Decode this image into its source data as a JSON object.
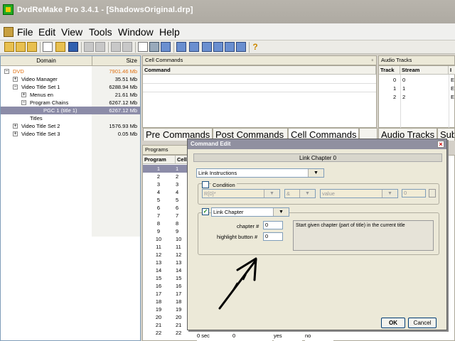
{
  "window": {
    "title": "DvdReMake Pro 3.4.1 - [ShadowsOriginal.drp]"
  },
  "menu": {
    "items": [
      "File",
      "Edit",
      "View",
      "Tools",
      "Window",
      "Help"
    ]
  },
  "tree": {
    "headers": {
      "domain": "Domain",
      "size": "Size"
    },
    "rows": [
      {
        "name": "DVD",
        "size": "7901.46 Mb",
        "orange": true
      },
      {
        "name": "Video Manager",
        "size": "35.51 Mb"
      },
      {
        "name": "Video Title Set 1",
        "size": "6288.94 Mb"
      },
      {
        "name": "Menus en",
        "size": "21.61 Mb"
      },
      {
        "name": "Program Chains",
        "size": "6267.12 Mb"
      },
      {
        "name": "PGC 1 (title 1)",
        "size": "6267.12 Mb",
        "selected": true
      },
      {
        "name": "Titles",
        "size": ""
      },
      {
        "name": "Video Title Set 2",
        "size": "1576.93 Mb"
      },
      {
        "name": "Video Title Set 3",
        "size": "0.05 Mb"
      }
    ]
  },
  "cell_commands": {
    "title": "Cell Commands",
    "column": "Command"
  },
  "audio_tracks": {
    "title": "Audio Tracks",
    "columns": [
      "Track",
      "Stream",
      "I"
    ],
    "rows": [
      [
        "0",
        "0",
        "E"
      ],
      [
        "1",
        "1",
        "E"
      ],
      [
        "2",
        "2",
        "E"
      ]
    ]
  },
  "tabs": [
    "Pre Commands",
    "Post Commands",
    "Cell Commands",
    "",
    "Audio Tracks",
    "Sub"
  ],
  "programs": {
    "title": "Programs",
    "columns": [
      "Program",
      "Cells"
    ],
    "rows": [
      [
        "1",
        "1"
      ],
      [
        "2",
        "2"
      ],
      [
        "3",
        "3"
      ],
      [
        "4",
        "4"
      ],
      [
        "5",
        "5"
      ],
      [
        "6",
        "6"
      ],
      [
        "7",
        "7"
      ],
      [
        "8",
        "8"
      ],
      [
        "9",
        "9"
      ],
      [
        "10",
        "10"
      ],
      [
        "11",
        "11"
      ],
      [
        "12",
        "12"
      ],
      [
        "13",
        "13"
      ],
      [
        "14",
        "14"
      ],
      [
        "15",
        "15"
      ],
      [
        "16",
        "16"
      ],
      [
        "17",
        "17"
      ],
      [
        "18",
        "18"
      ],
      [
        "19",
        "19"
      ],
      [
        "20",
        "20"
      ],
      [
        "21",
        "21"
      ],
      [
        "22",
        "22"
      ]
    ],
    "last_row_extra": [
      "0 sec",
      "0",
      "yes",
      "no"
    ]
  },
  "dialog": {
    "title": "Command Edit",
    "caption": "Link Chapter 0",
    "instruction_type": "Link Instructions",
    "condition": {
      "label": "Condition",
      "register": "R[0]*",
      "operator": "&",
      "value_placeholder": "value",
      "value": "0"
    },
    "link": {
      "selected": "Link Chapter",
      "chapter_label": "chapter #",
      "chapter_value": "0",
      "highlight_label": "highlight button #",
      "highlight_value": "0",
      "description": "Start given chapter (part of title) in the current title"
    },
    "ok": "OK",
    "cancel": "Cancel"
  }
}
